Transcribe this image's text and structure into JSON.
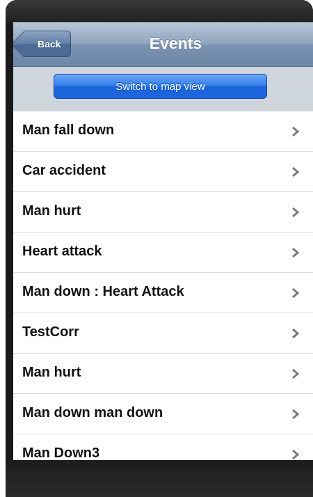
{
  "navbar": {
    "back_label": "Back",
    "title": "Events"
  },
  "toolbar": {
    "map_button_label": "Switch to map view"
  },
  "events": [
    {
      "label": "Man fall down"
    },
    {
      "label": "Car accident"
    },
    {
      "label": "Man hurt"
    },
    {
      "label": "Heart attack"
    },
    {
      "label": "Man down : Heart Attack"
    },
    {
      "label": "TestCorr"
    },
    {
      "label": "Man hurt"
    },
    {
      "label": "Man down man down"
    },
    {
      "label": "Man Down3"
    }
  ],
  "icons": {
    "row_disclosure": "chevron-right-icon"
  },
  "colors": {
    "navbar": "#6d87a8",
    "map_button": "#1e66dc",
    "toolbar_bg": "#cfd6de"
  }
}
